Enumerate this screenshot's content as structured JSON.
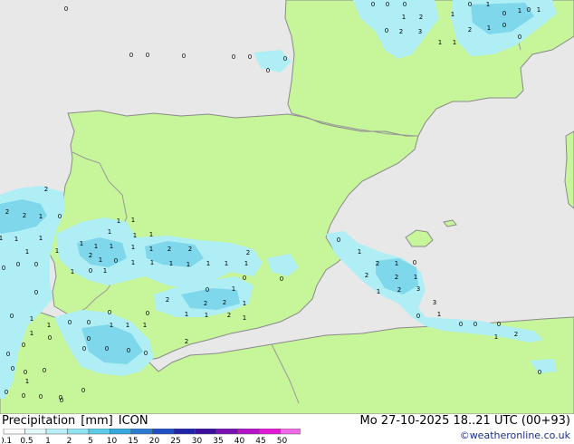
{
  "map": {
    "colors": {
      "sea": "#e8e8e8",
      "land": "#c6f59a",
      "border": "#9a9a9a",
      "coast": "#8a8a8a",
      "precip_light": "#aeeef4",
      "precip_mid": "#7fd7ec",
      "label": "#000000"
    },
    "labels": [
      "0",
      "0",
      "0",
      "0",
      "0",
      "1",
      "0",
      "1",
      "1",
      "2",
      "1",
      "0",
      "1",
      "0",
      "2",
      "3",
      "1",
      "1",
      "2",
      "1",
      "0",
      "0",
      "0",
      "0",
      "0",
      "0",
      "0",
      "0",
      "0",
      "2",
      "2",
      "2",
      "1",
      "0",
      "1",
      "1",
      "1",
      "1",
      "0",
      "0",
      "0",
      "1",
      "1",
      "1",
      "1",
      "1",
      "1",
      "1",
      "1",
      "1",
      "1",
      "2",
      "2",
      "2",
      "1",
      "2",
      "1",
      "0",
      "1",
      "1",
      "1",
      "1",
      "1",
      "1",
      "1",
      "0",
      "1",
      "1",
      "0",
      "0",
      "0",
      "1",
      "2",
      "2",
      "2",
      "1",
      "0",
      "0",
      "1",
      "1",
      "2",
      "1",
      "0",
      "0",
      "1",
      "1",
      "1",
      "1",
      "1",
      "0",
      "0",
      "0",
      "0",
      "0",
      "0",
      "0",
      "2",
      "0",
      "1",
      "2",
      "1",
      "0",
      "2",
      "2",
      "1",
      "2",
      "3",
      "1",
      "3",
      "1",
      "0",
      "0",
      "0",
      "0",
      "1",
      "2",
      "0",
      "0",
      "1",
      "0",
      "0",
      "0",
      "0",
      "0",
      "0",
      "0",
      "0",
      "0",
      "0",
      "0",
      "1",
      "0"
    ]
  },
  "footer": {
    "title_parts": [
      "Precipitation",
      "[mm]",
      "ICON"
    ],
    "datetime": "Mo 27-10-2025 18..21 UTC (00+93)",
    "credit": "©weatheronline.co.uk"
  },
  "legend": {
    "ticks": [
      "0.1",
      "0.5",
      "1",
      "2",
      "5",
      "10",
      "15",
      "20",
      "25",
      "30",
      "35",
      "40",
      "45",
      "50"
    ],
    "colors": [
      "#fdfdfd",
      "#e2f9fb",
      "#b9f0f7",
      "#8fe3f2",
      "#5ccbe6",
      "#36a8dc",
      "#2b7cd0",
      "#1f4fc4",
      "#1f25a8",
      "#3b0f9c",
      "#7a10b4",
      "#b414c8",
      "#e21ad6",
      "#f06ae6"
    ]
  }
}
